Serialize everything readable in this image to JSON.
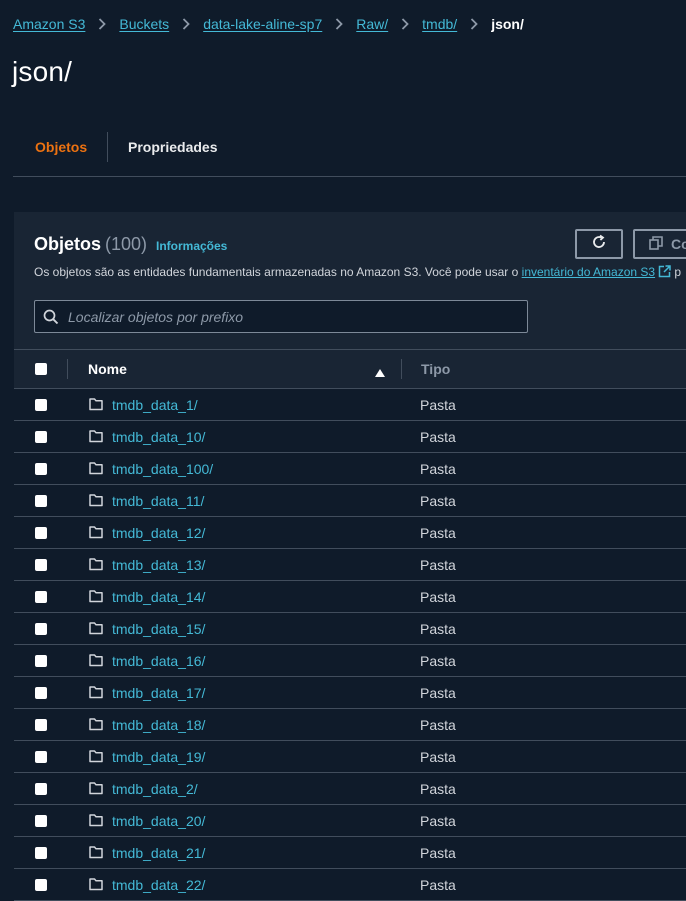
{
  "breadcrumb": {
    "items": [
      "Amazon S3",
      "Buckets",
      "data-lake-aline-sp7",
      "Raw/",
      "tmdb/"
    ],
    "current": "json/"
  },
  "page": {
    "title": "json/"
  },
  "tabs": {
    "objects": "Objetos",
    "properties": "Propriedades"
  },
  "panel": {
    "title": "Objetos",
    "count": "(100)",
    "info": "Informações",
    "description": "Os objetos são as entidades fundamentais armazenadas no Amazon S3. Você pode usar o",
    "description_link": "inventário do Amazon S3",
    "description_after": "p",
    "copy_button_label": "Copiar"
  },
  "search": {
    "placeholder": "Localizar objetos por prefixo"
  },
  "table": {
    "columns": {
      "name": "Nome",
      "type": "Tipo"
    },
    "rows": [
      {
        "name": "tmdb_data_1/",
        "type": "Pasta"
      },
      {
        "name": "tmdb_data_10/",
        "type": "Pasta"
      },
      {
        "name": "tmdb_data_100/",
        "type": "Pasta"
      },
      {
        "name": "tmdb_data_11/",
        "type": "Pasta"
      },
      {
        "name": "tmdb_data_12/",
        "type": "Pasta"
      },
      {
        "name": "tmdb_data_13/",
        "type": "Pasta"
      },
      {
        "name": "tmdb_data_14/",
        "type": "Pasta"
      },
      {
        "name": "tmdb_data_15/",
        "type": "Pasta"
      },
      {
        "name": "tmdb_data_16/",
        "type": "Pasta"
      },
      {
        "name": "tmdb_data_17/",
        "type": "Pasta"
      },
      {
        "name": "tmdb_data_18/",
        "type": "Pasta"
      },
      {
        "name": "tmdb_data_19/",
        "type": "Pasta"
      },
      {
        "name": "tmdb_data_2/",
        "type": "Pasta"
      },
      {
        "name": "tmdb_data_20/",
        "type": "Pasta"
      },
      {
        "name": "tmdb_data_21/",
        "type": "Pasta"
      },
      {
        "name": "tmdb_data_22/",
        "type": "Pasta"
      }
    ]
  },
  "colors": {
    "link": "#44b9d6",
    "accent": "#ec7211",
    "background": "#0f1b2a",
    "panel": "#192534"
  }
}
